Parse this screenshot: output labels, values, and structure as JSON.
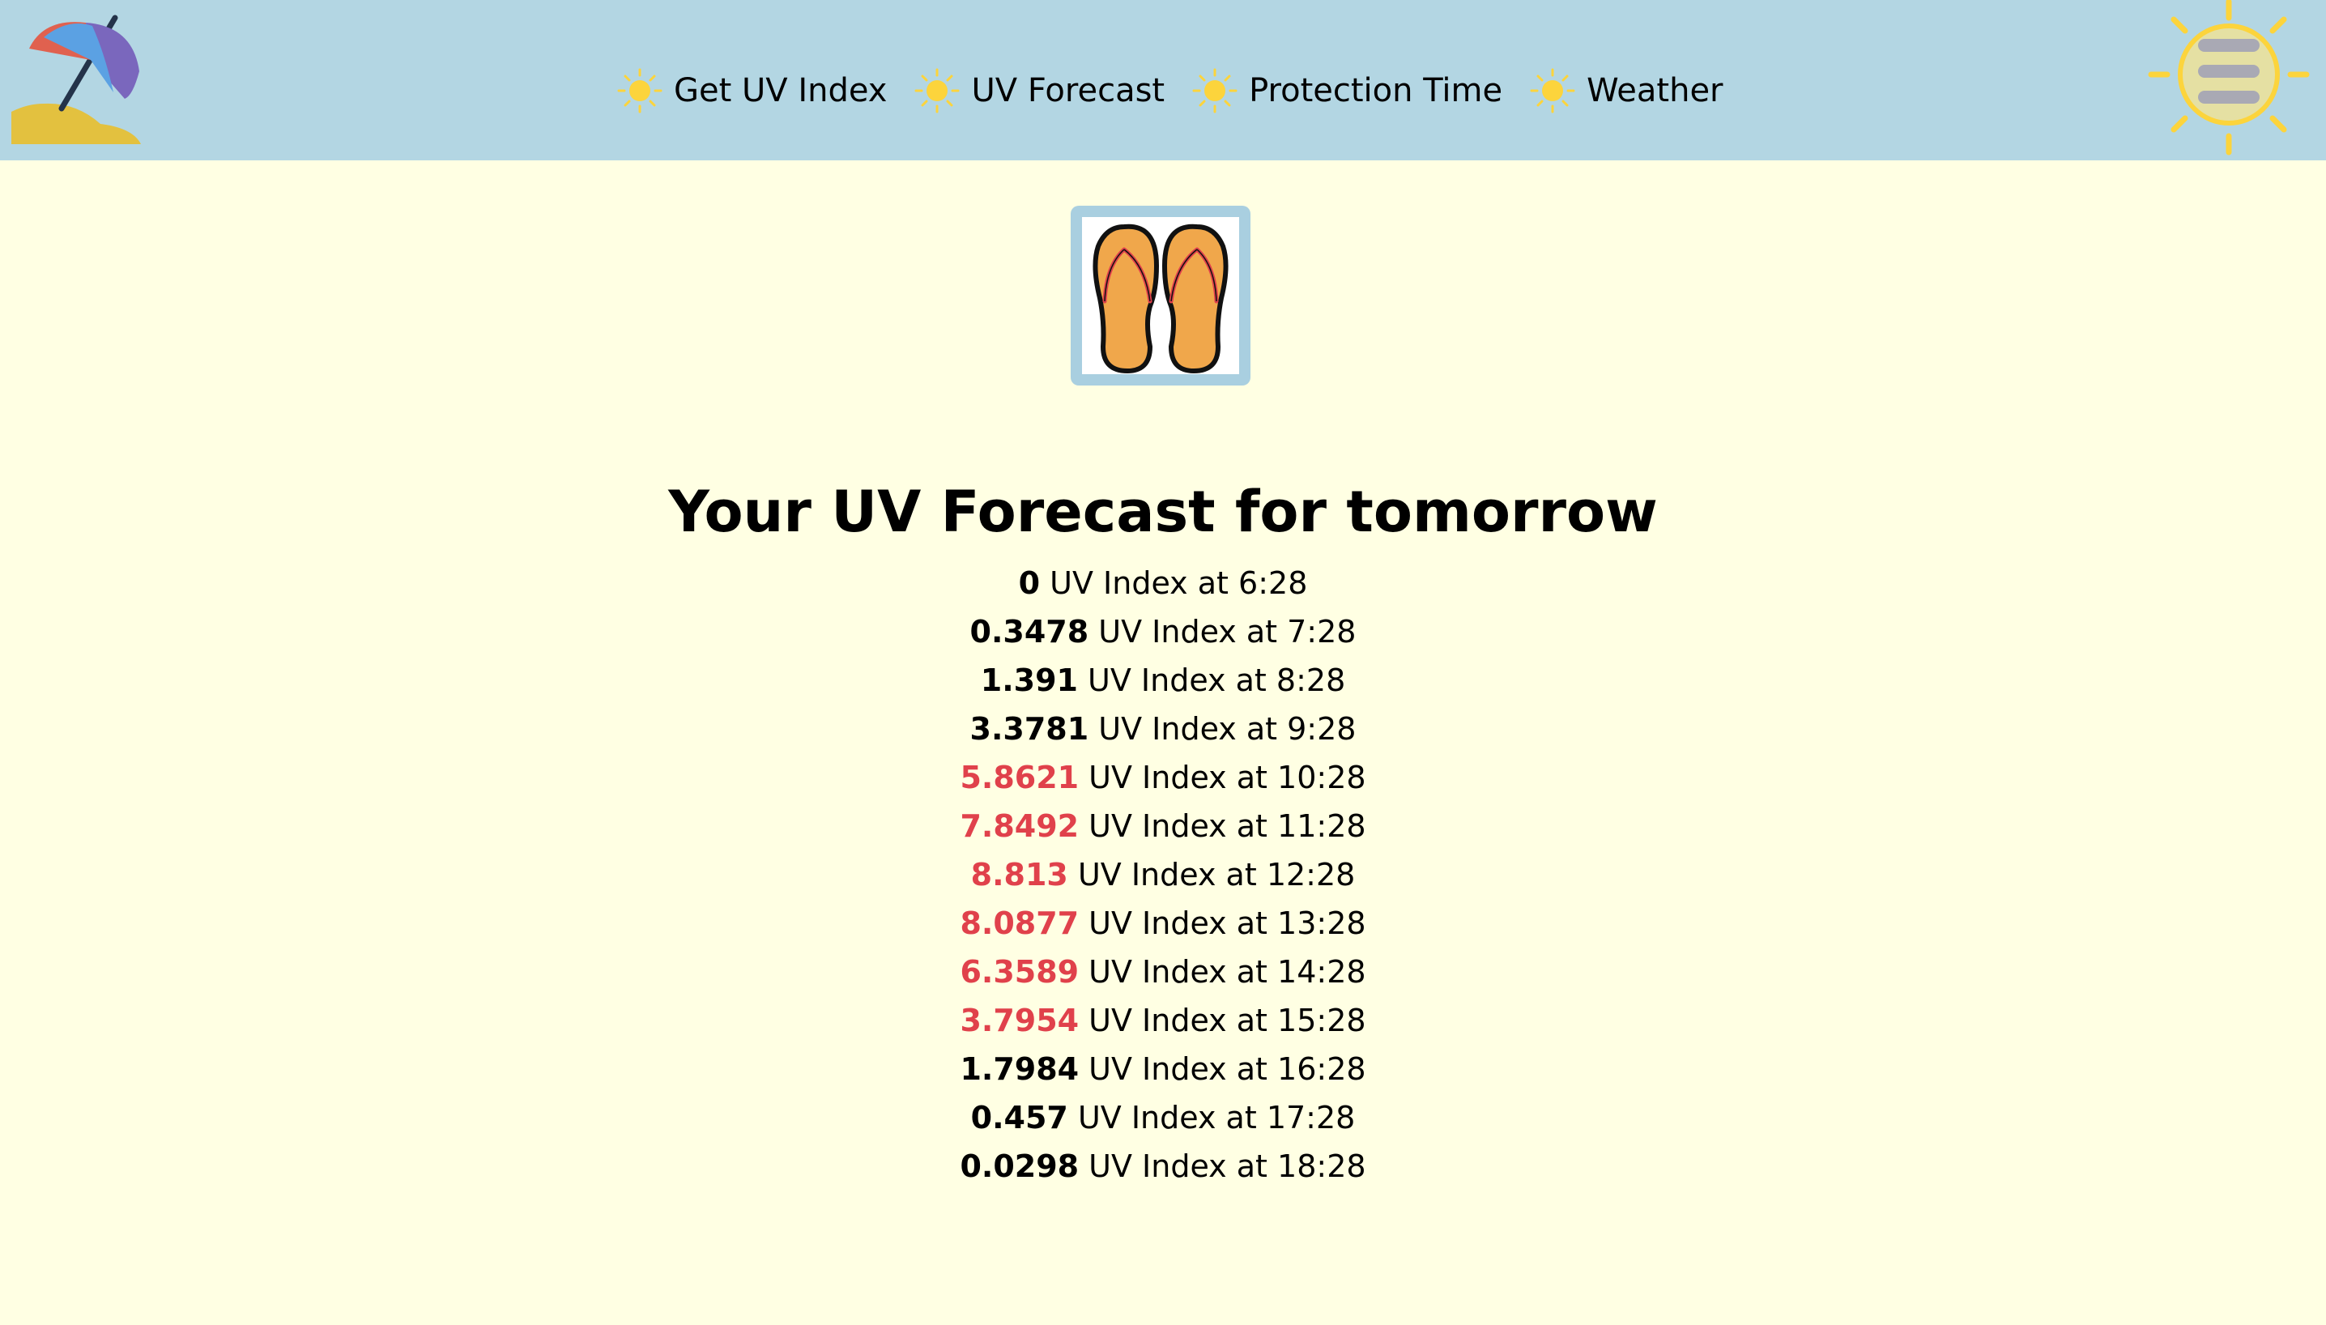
{
  "nav": {
    "items": [
      {
        "label": "Get UV Index",
        "icon": "sun-icon"
      },
      {
        "label": "UV Forecast",
        "icon": "sun-icon"
      },
      {
        "label": "Protection Time",
        "icon": "sun-icon"
      },
      {
        "label": "Weather",
        "icon": "sun-icon"
      }
    ],
    "logo_icon": "beach-umbrella-icon",
    "menu_icon": "sun-hamburger-menu-icon"
  },
  "hero": {
    "icon": "flip-flops-icon"
  },
  "page": {
    "title": "Your UV Forecast for tomorrow",
    "row_suffix": "UV Index at"
  },
  "forecast": [
    {
      "value": "0",
      "time": "6:28",
      "high": false
    },
    {
      "value": "0.3478",
      "time": "7:28",
      "high": false
    },
    {
      "value": "1.391",
      "time": "8:28",
      "high": false
    },
    {
      "value": "3.3781",
      "time": "9:28",
      "high": false
    },
    {
      "value": "5.8621",
      "time": "10:28",
      "high": true
    },
    {
      "value": "7.8492",
      "time": "11:28",
      "high": true
    },
    {
      "value": "8.813",
      "time": "12:28",
      "high": true
    },
    {
      "value": "8.0877",
      "time": "13:28",
      "high": true
    },
    {
      "value": "6.3589",
      "time": "14:28",
      "high": true
    },
    {
      "value": "3.7954",
      "time": "15:28",
      "high": true
    },
    {
      "value": "1.7984",
      "time": "16:28",
      "high": false
    },
    {
      "value": "0.457",
      "time": "17:28",
      "high": false
    },
    {
      "value": "0.0298",
      "time": "18:28",
      "high": false
    }
  ],
  "colors": {
    "navbar": "#b3d6e3",
    "background": "#ffffe3",
    "high_value": "#e0414b",
    "sun": "#fcd43c"
  }
}
